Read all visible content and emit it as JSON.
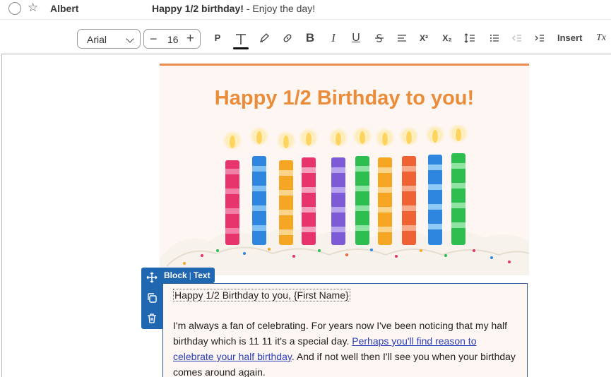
{
  "message": {
    "sender": "Albert",
    "subject": "Happy 1/2 birthday!",
    "preview": " - Enjoy the day!"
  },
  "toolbar": {
    "font_value": "Arial",
    "size_value": "16",
    "paragraph_label": "P",
    "bold_label": "B",
    "italic_label": "I",
    "underline_label": "U",
    "superscript_label": "X²",
    "subscript_label": "X₂",
    "insert_label": "Insert",
    "clear_format_label": "Tx"
  },
  "email": {
    "hero_title": "Happy 1/2 Birthday to you!",
    "greeting": "Happy 1/2 Birthday to you, {First Name}",
    "para_before_link": "I'm always a fan of celebrating. For years now I've been noticing that my half birthday which is 11 11 it's a special day. ",
    "link_text": "Perhaps you'll find reason to celebrate your half birthday",
    "para_after_link": ". And if not well then I'll see you when your birthday comes around again."
  },
  "block_editor": {
    "block_label": "Block",
    "separator": "|",
    "type_label": "Text"
  },
  "colors": {
    "accent_orange": "#e98a4e",
    "title_orange": "#ea8c3a",
    "block_blue": "#1f67b0",
    "link_blue": "#2a3fb8"
  }
}
